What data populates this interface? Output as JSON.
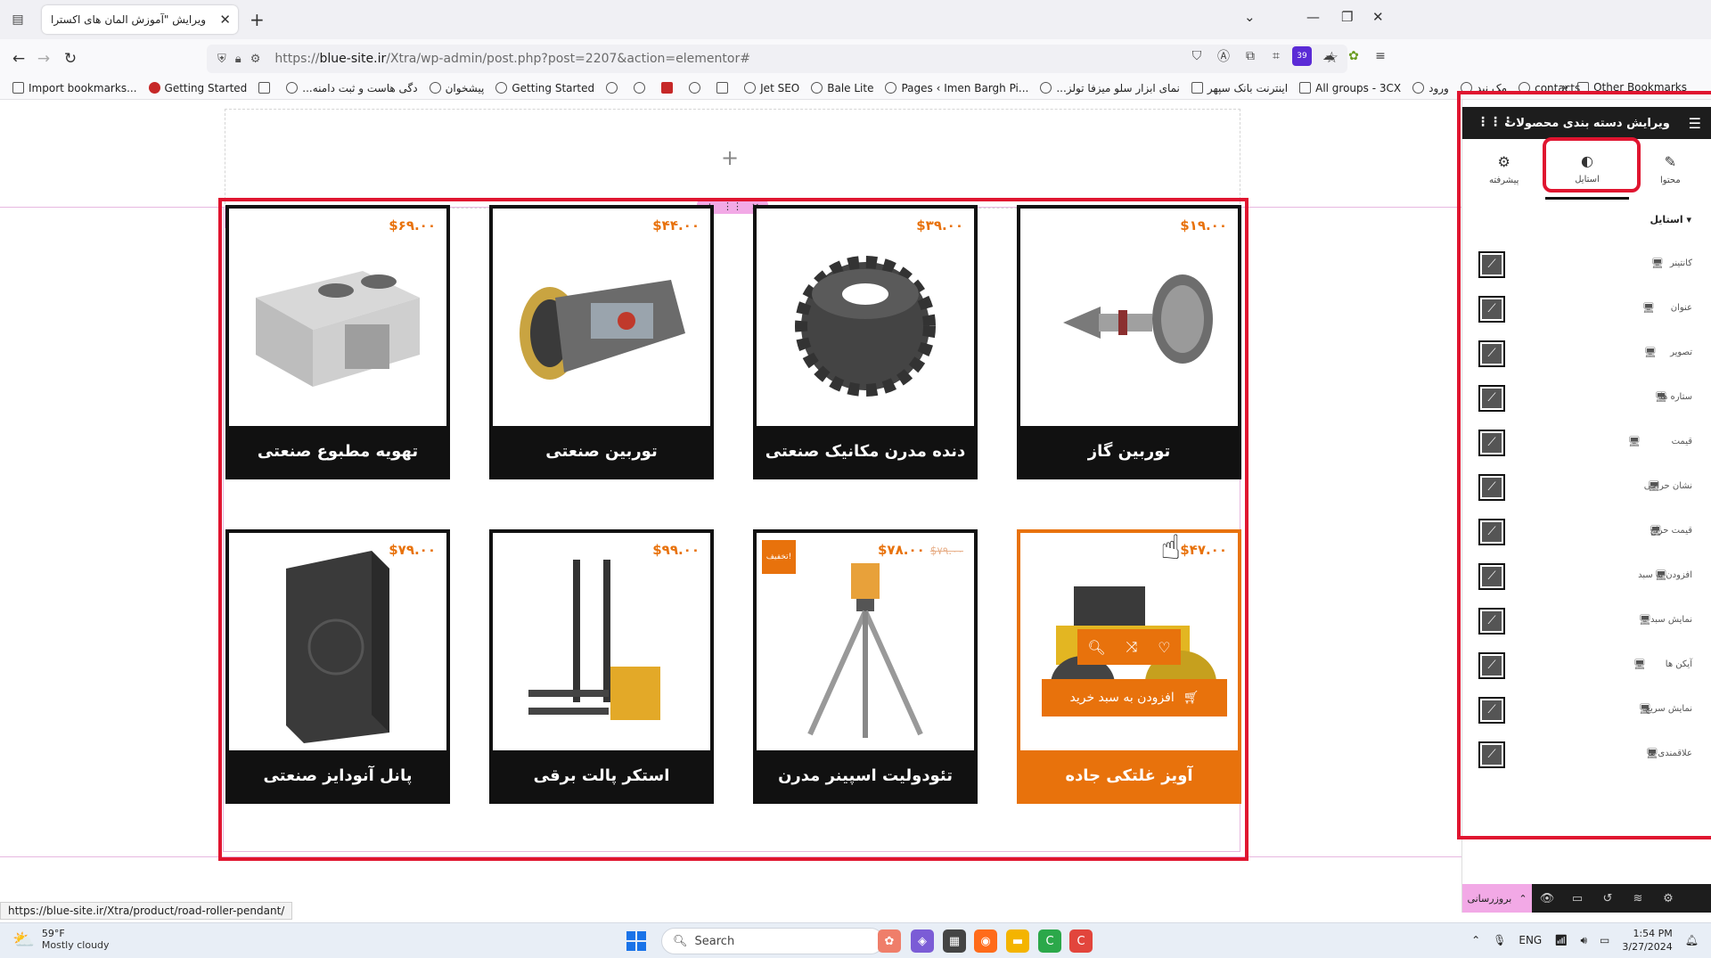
{
  "browser": {
    "tab_title": "ویرایش \"آموزش المان های اکسترا - ه",
    "url_prefix": "https://",
    "url_domain": "blue-site.ir",
    "url_path": "/Xtra/wp-admin/post.php?post=2207&action=elementor#",
    "extension_badge": "39",
    "bookmarks": [
      "Import bookmarks...",
      "Getting Started",
      "...دگی هاست و ثبت دامنه",
      "پیشخوان",
      "Getting Started",
      "Jet SEO",
      "Bale Lite",
      "Pages ‹ Imen Bargh Pi...",
      "...نمای ابزار سلو میزفا تولز",
      "اینترنت بانک سپهر",
      "All groups - 3CX",
      "ورود",
      "مک نید",
      "contacts"
    ],
    "other_bookmarks": "Other Bookmarks"
  },
  "colors": {
    "accent_orange": "#e8720c",
    "card_dark": "#111111",
    "highlight_red": "#e01530",
    "elementor_pink": "#f2a9e6"
  },
  "products": [
    {
      "title": "توربین گاز",
      "price": "$۱۹.۰۰",
      "old_price": "",
      "badge": "",
      "icon": "gas-turbine-image"
    },
    {
      "title": "دنده مدرن مکانیک صنعتی",
      "price": "$۳۹.۰۰",
      "old_price": "",
      "badge": "",
      "icon": "gear-image"
    },
    {
      "title": "توربین صنعتی",
      "price": "$۴۴.۰۰",
      "old_price": "",
      "badge": "",
      "icon": "jet-turbine-image"
    },
    {
      "title": "تهویه مطبوع صنعتی",
      "price": "$۶۹.۰۰",
      "old_price": "",
      "badge": "",
      "icon": "hvac-unit-image"
    },
    {
      "title": "آویز غلتکی جاده",
      "price": "$۴۷.۰۰",
      "old_price": "",
      "badge": "",
      "icon": "road-roller-image"
    },
    {
      "title": "تئودولیت اسپینر مدرن",
      "price": "$۷۸.۰۰",
      "old_price": "$۷۹.۰۰",
      "badge": "تخفیف!",
      "icon": "theodolite-image"
    },
    {
      "title": "استکر پالت برقی",
      "price": "$۹۹.۰۰",
      "old_price": "",
      "badge": "",
      "icon": "pallet-stacker-image"
    },
    {
      "title": "پانل آنودایز صنعتی",
      "price": "$۷۹.۰۰",
      "old_price": "",
      "badge": "",
      "icon": "anodized-panel-image"
    }
  ],
  "hover_card": {
    "add_to_cart": "افزودن به سبد خرید"
  },
  "status_url": "https://blue-site.ir/Xtra/product/road-roller-pendant/",
  "panel": {
    "title": "ویرایش دسته بندی محصولات",
    "tabs": [
      "محتوا",
      "استایل",
      "پیشرفته"
    ],
    "active_tab": "استایل",
    "section_title": "استایل",
    "controls": [
      "کانتینر",
      "عنوان",
      "تصویر",
      "ستاره ها",
      "قیمت",
      "نشان حراجی",
      "قیمت حراج",
      "افزودن به سبد",
      "نمایش سبد",
      "آیکن ها",
      "نمایش سریع",
      "علاقمندی ها"
    ],
    "update_label": "بروزرسانی"
  },
  "taskbar": {
    "temperature": "59°F",
    "weather": "Mostly cloudy",
    "search_placeholder": "Search",
    "language": "ENG",
    "time": "1:54 PM",
    "date": "3/27/2024"
  }
}
